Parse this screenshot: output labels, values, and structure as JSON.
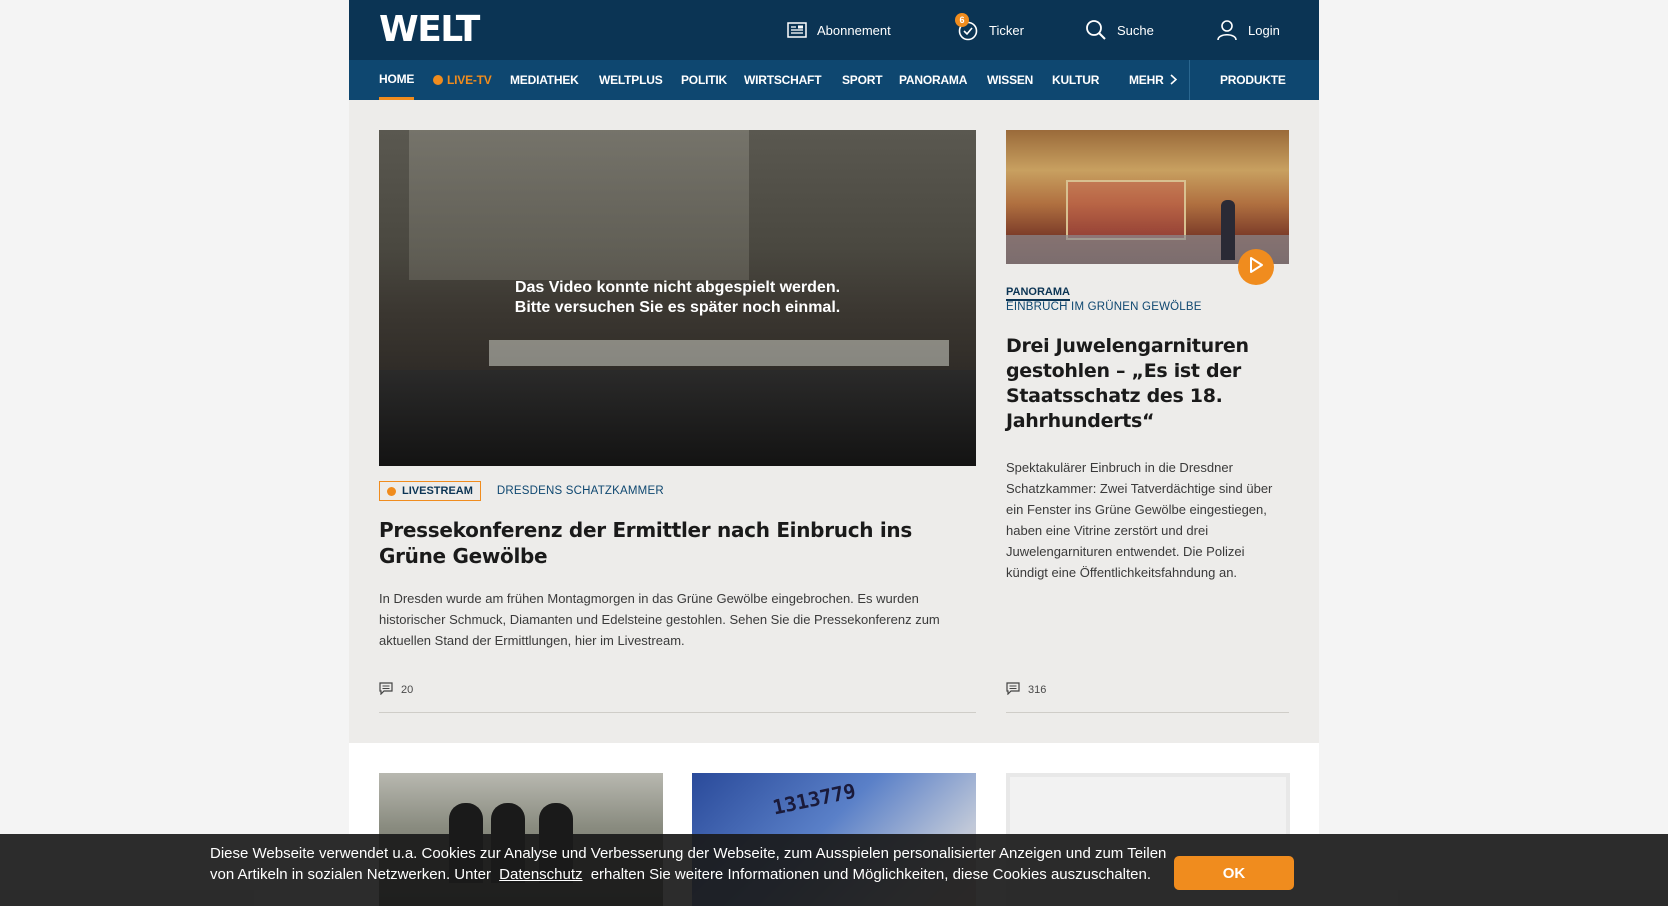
{
  "header": {
    "logo": "WELT",
    "links": {
      "subscription": "Abonnement",
      "ticker": "Ticker",
      "ticker_count": "6",
      "search": "Suche",
      "login": "Login"
    }
  },
  "nav": {
    "items": [
      "HOME",
      "LIVE-TV",
      "MEDIATHEK",
      "WELTPLUS",
      "POLITIK",
      "WIRTSCHAFT",
      "SPORT",
      "PANORAMA",
      "WISSEN",
      "KULTUR",
      "MEHR"
    ],
    "products": "PRODUKTE"
  },
  "main_story": {
    "video_error_line1": "Das Video konnte nicht abgespielt werden.",
    "video_error_line2": "Bitte versuchen Sie es später noch einmal.",
    "tag": "LIVESTREAM",
    "kicker": "DRESDENS SCHATZKAMMER",
    "headline": "Pressekonferenz der Ermittler nach Einbruch ins Grüne Gewölbe",
    "teaser": "In Dresden wurde am frühen Montagmorgen in das Grüne Gewölbe eingebrochen. Es wurden historischer Schmuck, Diamanten und Edelsteine gestohlen. Sehen Sie die Pressekonferenz zum aktuellen Stand der Ermittlungen, hier im Livestream.",
    "comments": "20"
  },
  "side_story": {
    "section": "PANORAMA",
    "kicker": "EINBRUCH IM GRÜNEN GEWÖLBE",
    "headline": "Drei Juwelengarnituren gestohlen – „Es ist der Staatsschatz des 18. Jahrhunderts“",
    "teaser": "Spektakulärer Einbruch in die Dresdner Schatzkammer: Zwei Tatverdächtige sind über ein Fenster ins Grüne Gewölbe eingestiegen, haben eine Vitrine zerstört und drei Juwelengarnituren entwendet. Die Polizei kündigt eine Öffentlichkeitsfahndung an.",
    "comments": "316"
  },
  "card2_image_text": "1313779",
  "cookie": {
    "text_before": "Diese Webseite verwendet u.a. Cookies zur Analyse und Verbesserung der Webseite, zum Ausspielen personalisierter Anzeigen und zum Teilen von Artikeln in sozialen Netzwerken. Unter",
    "link": "Datenschutz",
    "text_after": "erhalten Sie weitere Informationen und Möglichkeiten, diese Cookies auszuschalten.",
    "button": "OK"
  },
  "colors": {
    "topbar": "#0b3454",
    "navbar": "#0e4770",
    "accent": "#f08c1e",
    "hero_bg": "#edecea"
  }
}
